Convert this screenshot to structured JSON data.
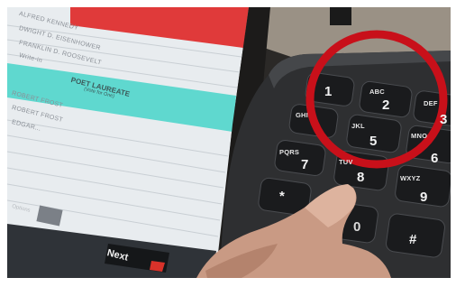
{
  "screen": {
    "ballot_lines": [
      "ALFRED KENNEDY",
      "DWIGHT D. EISENHOWER",
      "FRANKLIN D. ROOSEVELT",
      "Write-in"
    ],
    "section_title": "POET LAUREATE",
    "section_subtitle": "(Vote for One)",
    "more_lines": [
      "ROBERT FROST",
      "ROBERT FROST",
      "EDGAR..."
    ],
    "side_label": "Options",
    "next_label": "Next"
  },
  "keypad": {
    "keys": [
      {
        "digit": "1",
        "letters": ""
      },
      {
        "digit": "2",
        "letters": "ABC"
      },
      {
        "digit": "3",
        "letters": "DEF"
      },
      {
        "digit": "4",
        "letters": "GHI"
      },
      {
        "digit": "5",
        "letters": "JKL"
      },
      {
        "digit": "6",
        "letters": "MNO"
      },
      {
        "digit": "7",
        "letters": "PQRS"
      },
      {
        "digit": "8",
        "letters": "TUV"
      },
      {
        "digit": "9",
        "letters": "WXYZ"
      },
      {
        "digit": "*",
        "letters": ""
      },
      {
        "digit": "0",
        "letters": ""
      },
      {
        "digit": "#",
        "letters": ""
      }
    ]
  },
  "colors": {
    "highlight_circle": "#c8101a",
    "teal_banner": "#5fd8cf",
    "red_strip": "#e03a3a",
    "keypad_body": "#2e2f31"
  }
}
